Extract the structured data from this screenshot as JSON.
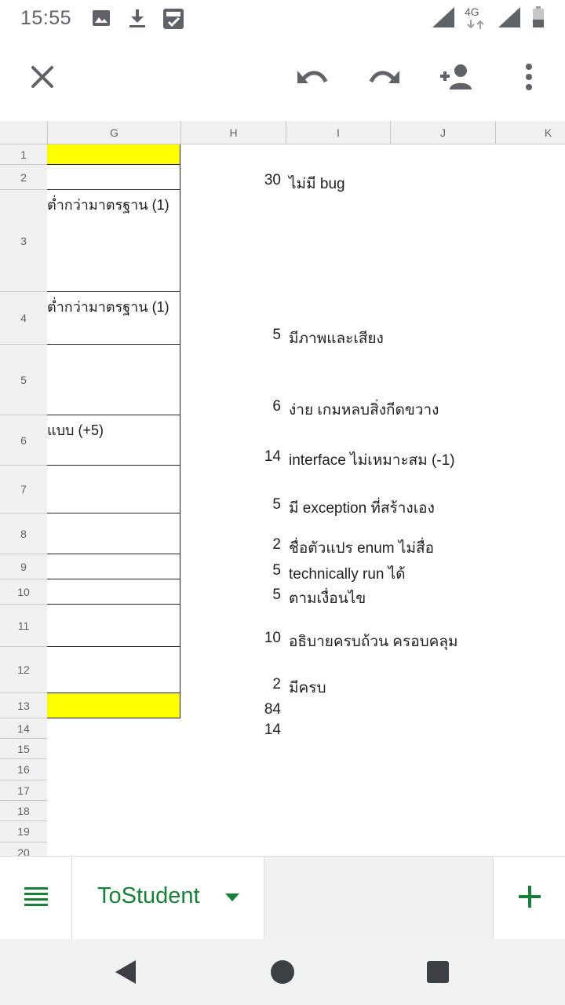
{
  "status_bar": {
    "time": "15:55",
    "network": "4G",
    "icons": [
      "image-icon",
      "download-icon",
      "saved-icon",
      "signal-icon",
      "signal-icon",
      "battery-icon"
    ]
  },
  "toolbar": {
    "icons": [
      "close-icon",
      "undo-icon",
      "redo-icon",
      "add-person-icon",
      "more-vert-icon"
    ]
  },
  "columns": [
    "G",
    "H",
    "I",
    "J",
    "K"
  ],
  "rows": [
    {
      "num": "1",
      "g": "",
      "h": "",
      "i": ""
    },
    {
      "num": "2",
      "g": "",
      "h": "30",
      "i": "ไม่มี bug"
    },
    {
      "num": "3",
      "g": "ต่ำกว่ามาตรฐาน (1)",
      "h": "",
      "i": ""
    },
    {
      "num": "4",
      "g": "ต่ำกว่ามาตรฐาน (1)",
      "h": "5",
      "i": "มีภาพและเสียง"
    },
    {
      "num": "5",
      "g": "",
      "h": "6",
      "i": "ง่าย เกมหลบสิ่งกีดขวาง"
    },
    {
      "num": "6",
      "g": "แบบ (+5)",
      "h": "14",
      "i": "interface ไม่เหมาะสม (-1)"
    },
    {
      "num": "7",
      "g": "",
      "h": "5",
      "i": "มี exception ที่สร้างเอง"
    },
    {
      "num": "8",
      "g": "",
      "h": "2",
      "i": "ชื่อตัวแปร enum ไม่สื่อ"
    },
    {
      "num": "9",
      "g": "",
      "h": "5",
      "i": "technically run ได้"
    },
    {
      "num": "10",
      "g": "",
      "h": "5",
      "i": "ตามเงื่อนไข"
    },
    {
      "num": "11",
      "g": "",
      "h": "10",
      "i": "อธิบายครบถ้วน ครอบคลุม"
    },
    {
      "num": "12",
      "g": "",
      "h": "2",
      "i": "มีครบ"
    },
    {
      "num": "13",
      "g": "",
      "h": "84",
      "i": ""
    },
    {
      "num": "14",
      "g": "",
      "h": "14",
      "i": ""
    },
    {
      "num": "15",
      "g": "",
      "h": "",
      "i": ""
    },
    {
      "num": "16",
      "g": "",
      "h": "",
      "i": ""
    },
    {
      "num": "17",
      "g": "",
      "h": "",
      "i": ""
    },
    {
      "num": "18",
      "g": "",
      "h": "",
      "i": ""
    },
    {
      "num": "19",
      "g": "",
      "h": "",
      "i": ""
    },
    {
      "num": "20",
      "g": "",
      "h": "",
      "i": ""
    }
  ],
  "highlight_color": "#ffff00",
  "sheet_tabs": {
    "active_label": "ToStudent",
    "accent": "#188038"
  },
  "nav_bar": {
    "icons": [
      "back-icon",
      "home-icon",
      "recents-icon"
    ]
  }
}
